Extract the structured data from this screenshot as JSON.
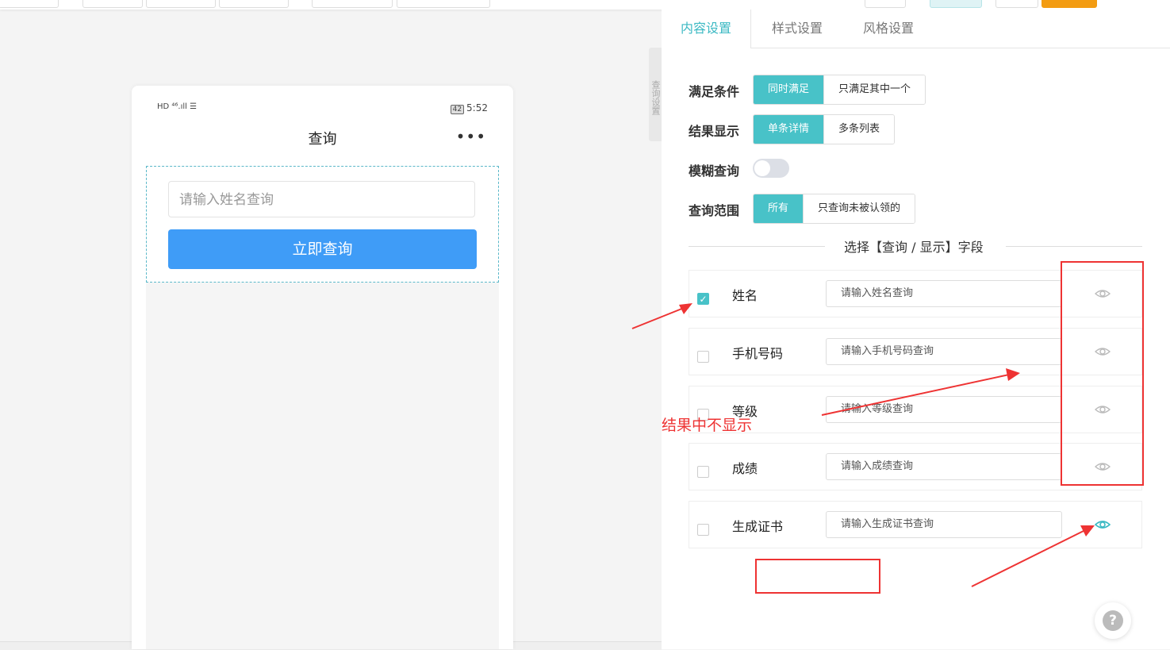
{
  "phone": {
    "signal_text": "HD ⁴⁶.ıll ☰",
    "battery": "42",
    "time": "5:52",
    "title": "查询",
    "more_icon": "•••",
    "search_placeholder": "请输入姓名查询",
    "query_button": "立即查询"
  },
  "side_tab": "查询设置",
  "tabs": [
    "内容设置",
    "样式设置",
    "风格设置"
  ],
  "settings": {
    "condition": {
      "label": "满足条件",
      "options": [
        "同时满足",
        "只满足其中一个"
      ],
      "selected": 0
    },
    "result": {
      "label": "结果显示",
      "options": [
        "单条详情",
        "多条列表"
      ],
      "selected": 0
    },
    "fuzzy": {
      "label": "模糊查询",
      "enabled": false
    },
    "scope": {
      "label": "查询范围",
      "options": [
        "所有",
        "只查询未被认领的"
      ],
      "selected": 0
    }
  },
  "fields_section_title": "选择【查询 / 显示】字段",
  "fields": [
    {
      "name": "姓名",
      "placeholder": "请输入姓名查询",
      "checked": true,
      "visible_icon": "eye-icon"
    },
    {
      "name": "手机号码",
      "placeholder": "请输入手机号码查询",
      "checked": false,
      "visible_icon": "eye-icon"
    },
    {
      "name": "等级",
      "placeholder": "请输入等级查询",
      "checked": false,
      "visible_icon": "eye-icon"
    },
    {
      "name": "成绩",
      "placeholder": "请输入成绩查询",
      "checked": false,
      "visible_icon": "eye-icon"
    },
    {
      "name": "生成证书",
      "placeholder": "请输入生成证书查询",
      "checked": false,
      "visible_icon": "eye-icon"
    }
  ],
  "help_icon": "?",
  "annotation": {
    "text": "结果中不显示",
    "color": "#e33333"
  },
  "colors": {
    "accent": "#48c2c8",
    "button_blue": "#3f9cf7",
    "annotation_red": "#e33333"
  }
}
